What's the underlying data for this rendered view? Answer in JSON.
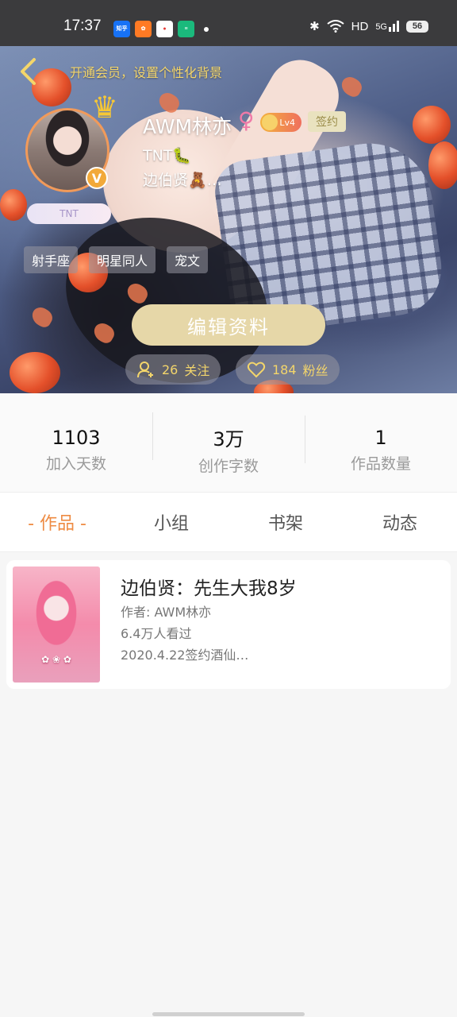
{
  "status_bar": {
    "time": "17:37",
    "apps": [
      {
        "name": "zhihu-app-icon",
        "label": "知乎",
        "color": "#1772f6"
      },
      {
        "name": "taobao-app-icon",
        "label": "",
        "color": "#ff7a24"
      },
      {
        "name": "map-app-icon",
        "label": "",
        "color": "#e53935"
      },
      {
        "name": "green-app-icon",
        "label": "",
        "color": "#1bb97c"
      }
    ],
    "network": "HD",
    "signal": "5G",
    "battery": "56"
  },
  "header": {
    "vip_banner": "开通会员，设置个性化背景",
    "username": "AWM林亦",
    "level": "Lv4",
    "signed_label": "签约",
    "bio_line1": "TNT🐛",
    "bio_line2": "边伯贤🧸…",
    "fan_badge": "TNT",
    "tags": [
      "射手座",
      "明星同人",
      "宠文"
    ],
    "edit_button": "编辑资料",
    "following_count": "26",
    "following_label": "关注",
    "fans_count": "184",
    "fans_label": "粉丝"
  },
  "stats": [
    {
      "value": "1103",
      "label": "加入天数"
    },
    {
      "value": "3万",
      "label": "创作字数"
    },
    {
      "value": "1",
      "label": "作品数量"
    }
  ],
  "tabs": [
    {
      "label": "- 作品 -",
      "active": true
    },
    {
      "label": "小组",
      "active": false
    },
    {
      "label": "书架",
      "active": false
    },
    {
      "label": "动态",
      "active": false
    }
  ],
  "works": [
    {
      "title": "边伯贤：先生大我8岁",
      "author": "作者: AWM林亦",
      "views": "6.4万人看过",
      "note": "2020.4.22签约酒仙…"
    }
  ],
  "colors": {
    "accent": "#ee8b43",
    "gold": "#f3d56b",
    "edit_button": "#e6d7a8"
  }
}
